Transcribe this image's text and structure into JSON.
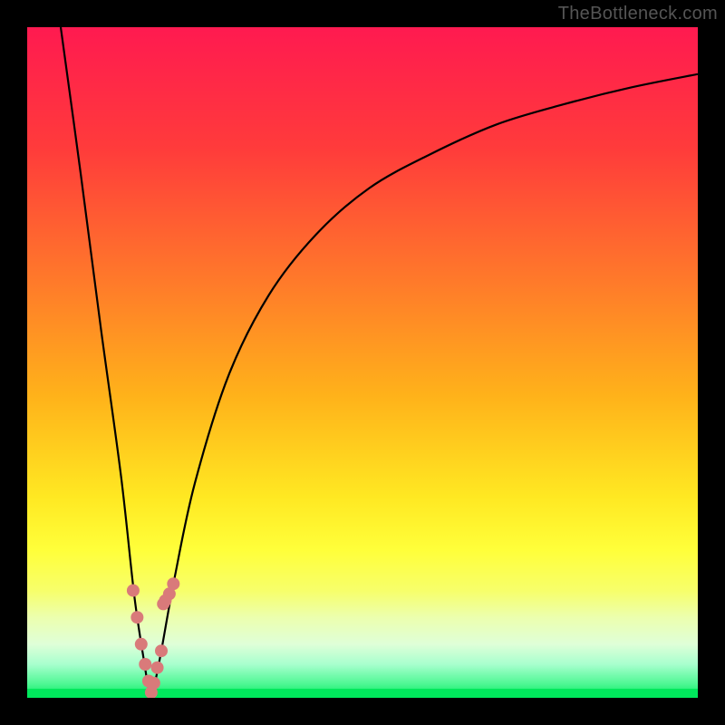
{
  "attribution": "TheBottleneck.com",
  "chart_data": {
    "type": "line",
    "title": "",
    "xlabel": "",
    "ylabel": "",
    "xlim": [
      0,
      100
    ],
    "ylim": [
      0,
      100
    ],
    "series": [
      {
        "name": "bottleneck-curve",
        "x": [
          5,
          8,
          11,
          14,
          16,
          17.5,
          18,
          18.5,
          19,
          20,
          22,
          25,
          30,
          36,
          43,
          51,
          60,
          70,
          80,
          90,
          100
        ],
        "y": [
          100,
          78,
          55,
          33,
          15,
          5,
          2,
          0.5,
          2,
          7,
          18,
          32,
          48,
          60,
          69,
          76,
          81,
          85.5,
          88.5,
          91,
          93
        ]
      }
    ],
    "markers": {
      "name": "highlight-points",
      "x": [
        15.8,
        16.4,
        17.0,
        17.6,
        18.1,
        18.5,
        18.9,
        19.4,
        20.0,
        20.3,
        20.6,
        21.2,
        21.8
      ],
      "y": [
        16,
        12,
        8,
        5,
        2.5,
        0.8,
        2.2,
        4.5,
        7,
        14,
        14.5,
        15.5,
        17
      ],
      "color": "#d97a7a",
      "radius": 7
    },
    "gradient_stops": [
      {
        "offset": 0,
        "color": "#ff1a50"
      },
      {
        "offset": 18,
        "color": "#ff3b3b"
      },
      {
        "offset": 38,
        "color": "#ff7a2a"
      },
      {
        "offset": 55,
        "color": "#ffb21a"
      },
      {
        "offset": 70,
        "color": "#ffe822"
      },
      {
        "offset": 78,
        "color": "#ffff3a"
      },
      {
        "offset": 84,
        "color": "#f7ff6a"
      },
      {
        "offset": 88,
        "color": "#ecffae"
      },
      {
        "offset": 92,
        "color": "#dfffd8"
      },
      {
        "offset": 95,
        "color": "#a8ffce"
      },
      {
        "offset": 98,
        "color": "#4cf792"
      },
      {
        "offset": 100,
        "color": "#00e85c"
      }
    ]
  }
}
